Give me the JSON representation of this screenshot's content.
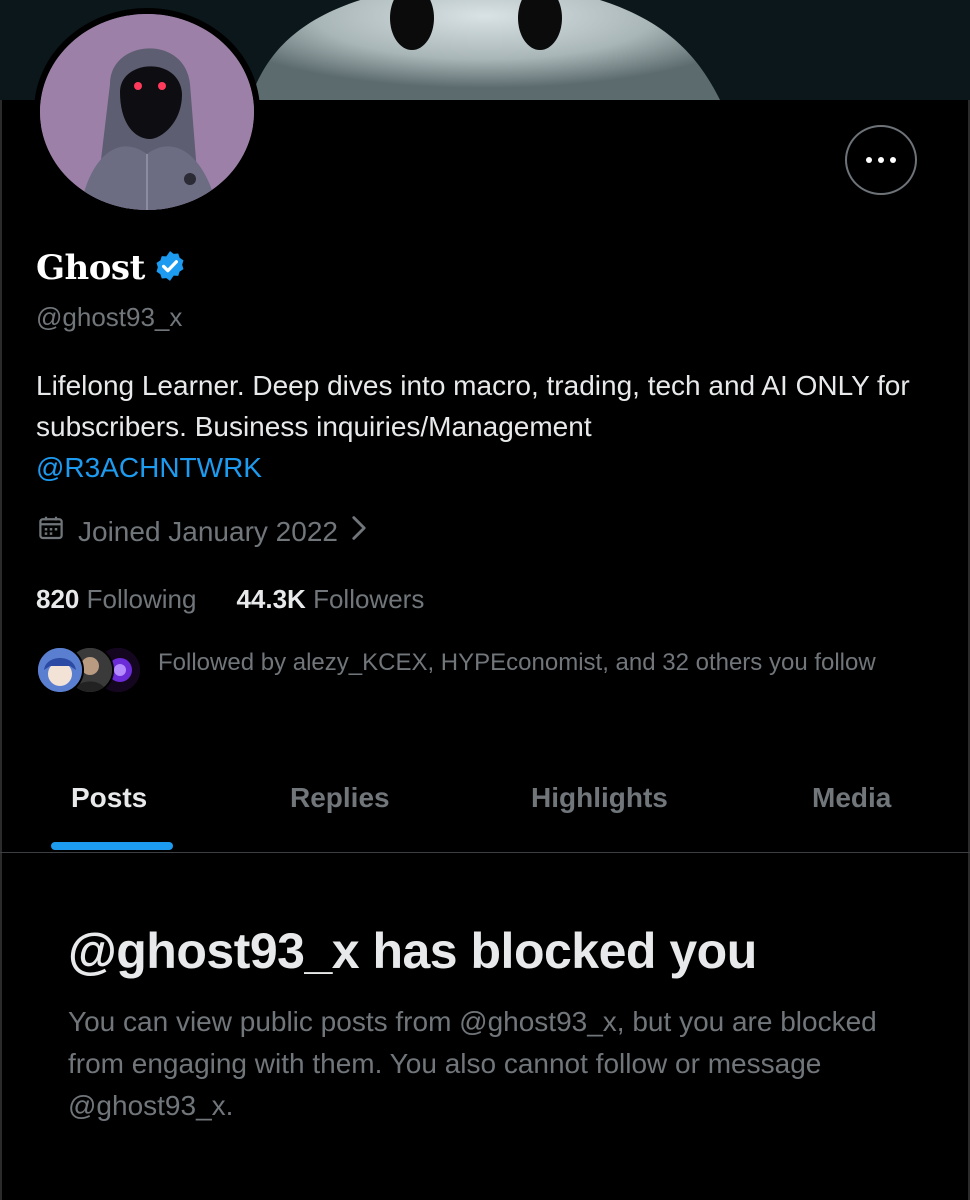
{
  "profile": {
    "display_name": "Ghost",
    "verified_badge_icon": "verified-badge-icon",
    "handle": "@ghost93_x",
    "bio_text": "Lifelong Learner. Deep dives into macro, trading, tech and AI ONLY for subscribers. Business inquiries/Management",
    "bio_link": "@R3ACHNTWRK",
    "joined_text": "Joined January 2022",
    "following_count": "820",
    "following_label": "Following",
    "followers_count": "44.3K",
    "followers_label": "Followers",
    "followed_by_text": "Followed by alezy_KCEX, HYPEconomist, and 32 others you follow"
  },
  "tabs": [
    {
      "label": "Posts",
      "active": true
    },
    {
      "label": "Replies",
      "active": false
    },
    {
      "label": "Highlights",
      "active": false
    },
    {
      "label": "Media",
      "active": false
    }
  ],
  "blocked": {
    "title": "@ghost93_x has blocked you",
    "text": "You can view public posts from @ghost93_x, but you are blocked from engaging with them. You also cannot follow or message @ghost93_x."
  },
  "colors": {
    "background": "#000000",
    "accent": "#1d9bf0",
    "primary_text": "#e7e9ea",
    "secondary_text": "#71767b"
  }
}
